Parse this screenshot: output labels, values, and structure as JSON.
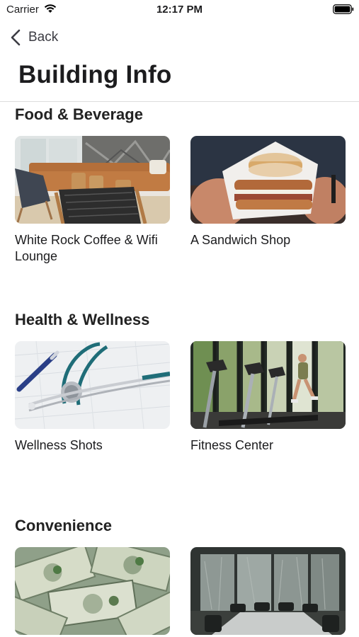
{
  "status_bar": {
    "carrier": "Carrier",
    "time": "12:17 PM"
  },
  "nav": {
    "back_label": "Back"
  },
  "page": {
    "title": "Building Info"
  },
  "sections": [
    {
      "title": "Food & Beverage",
      "cards": [
        {
          "label": "White Rock Coffee & Wifi Lounge",
          "image": "lounge-photo"
        },
        {
          "label": "A Sandwich Shop",
          "image": "sandwich-photo"
        }
      ]
    },
    {
      "title": "Health & Wellness",
      "cards": [
        {
          "label": "Wellness Shots",
          "image": "stethoscope-photo"
        },
        {
          "label": "Fitness Center",
          "image": "treadmill-photo"
        }
      ]
    },
    {
      "title": "Convenience",
      "cards": [
        {
          "label": "",
          "image": "money-photo"
        },
        {
          "label": "",
          "image": "conference-room-photo"
        }
      ]
    }
  ],
  "colors": {
    "text": "#1c1c1e",
    "divider": "#dcdcdc",
    "background": "#ffffff"
  }
}
